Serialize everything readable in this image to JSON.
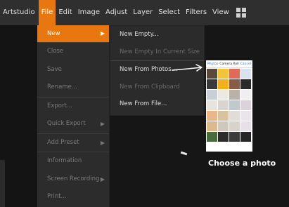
{
  "menubar": {
    "brand": "Artstudio",
    "items": [
      "File",
      "Edit",
      "Image",
      "Adjust",
      "Layer",
      "Select",
      "Filters",
      "View"
    ],
    "active": "File",
    "accent": "#e7770e"
  },
  "file_menu": {
    "items": [
      {
        "label": "New",
        "arrow": "▶"
      },
      {
        "label": "Close"
      },
      {
        "label": "Save"
      },
      {
        "label": "Rename..."
      },
      {
        "label": "Export..."
      },
      {
        "label": "Quick Export",
        "arrow": "▶"
      },
      {
        "label": "Add Preset",
        "arrow": "▶"
      },
      {
        "label": "Information"
      },
      {
        "label": "Screen Recording",
        "arrow": "▶"
      },
      {
        "label": "Print..."
      }
    ]
  },
  "submenu": {
    "items": [
      {
        "label": "New Empty..."
      },
      {
        "label": "New Empty In Current Size"
      },
      {
        "label": "New From Photos..."
      },
      {
        "label": "New From Clipboard"
      },
      {
        "label": "New From File..."
      }
    ]
  },
  "picker": {
    "back": "Photos",
    "title": "Camera Roll",
    "cancel": "Cancel"
  },
  "caption": "Choose a photo"
}
